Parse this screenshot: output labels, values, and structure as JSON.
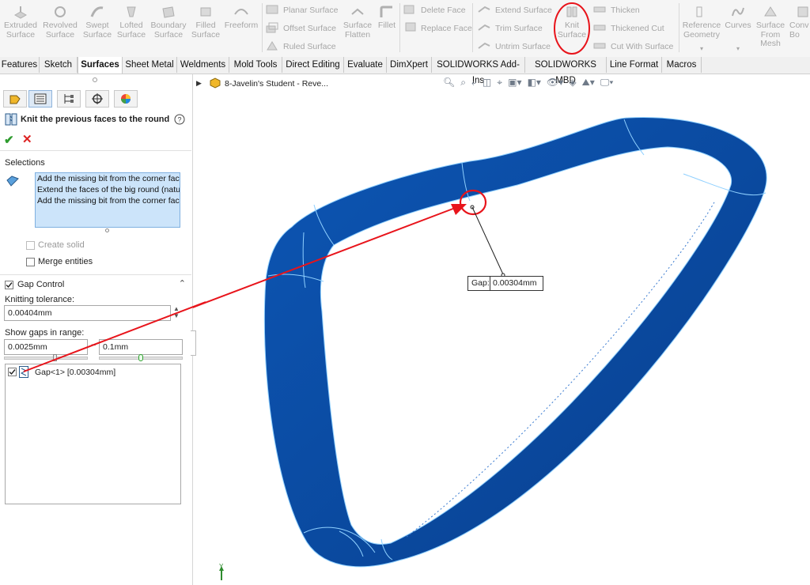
{
  "ribbon": {
    "big_buttons": [
      {
        "line1": "Extruded",
        "line2": "Surface",
        "icon": "extruded-surface-icon"
      },
      {
        "line1": "Revolved",
        "line2": "Surface",
        "icon": "revolved-surface-icon"
      },
      {
        "line1": "Swept",
        "line2": "Surface",
        "icon": "swept-surface-icon"
      },
      {
        "line1": "Lofted",
        "line2": "Surface",
        "icon": "lofted-surface-icon"
      },
      {
        "line1": "Boundary",
        "line2": "Surface",
        "icon": "boundary-surface-icon"
      },
      {
        "line1": "Filled",
        "line2": "Surface",
        "icon": "filled-surface-icon"
      },
      {
        "line1": "Freeform",
        "line2": "",
        "icon": "freeform-icon"
      }
    ],
    "col1": [
      "Planar Surface",
      "Offset Surface",
      "Ruled Surface"
    ],
    "surface_flatten": {
      "line1": "Surface",
      "line2": "Flatten"
    },
    "fillet": "Fillet",
    "col2": [
      "Delete Face",
      "Replace Face"
    ],
    "col3": [
      "Extend Surface",
      "Trim Surface",
      "Untrim Surface"
    ],
    "knit": {
      "line1": "Knit",
      "line2": "Surface"
    },
    "col4": [
      "Thicken",
      "Thickened Cut",
      "Cut With Surface"
    ],
    "reference_geometry": {
      "line1": "Reference",
      "line2": "Geometry"
    },
    "curves": "Curves",
    "surface_from_mesh": {
      "line1": "Surface",
      "line2": "From",
      "line3": "Mesh"
    },
    "convert": {
      "line1": "Conv",
      "line2": "Bo"
    },
    "highlight_color": "#e8141b"
  },
  "tabs": [
    "Features",
    "Sketch",
    "Surfaces",
    "Sheet Metal",
    "Weldments",
    "Mold Tools",
    "Direct Editing",
    "Evaluate",
    "DimXpert",
    "SOLIDWORKS Add-Ins",
    "SOLIDWORKS MBD",
    "Line Format",
    "Macros"
  ],
  "active_tab": "Surfaces",
  "panel": {
    "title": "Knit the previous faces to the round",
    "help_icon": "help-icon",
    "selections_label": "Selections",
    "selections": [
      "Add the missing bit from the corner face",
      "Extend the faces of the big round (natural",
      "Add the missing bit from the corner face"
    ],
    "create_solid": "Create solid",
    "merge_entities": "Merge entities",
    "gap_control": "Gap Control",
    "knitting_tolerance_label": "Knitting tolerance:",
    "knitting_tolerance": "0.00404mm",
    "show_gaps_label": "Show gaps in range:",
    "gap_min": "0.0025mm",
    "gap_separator": "~",
    "gap_max": "0.1mm",
    "gap_item": "Gap<1>  [0.00304mm]"
  },
  "viewport": {
    "doc_title": "8-Javelin's Student - Reve...",
    "gap_label": "Gap:",
    "gap_value": "0.00304mm",
    "axis_label": "Y",
    "body_color": "#0a4aa0",
    "edge_color": "#8fd0ff"
  }
}
